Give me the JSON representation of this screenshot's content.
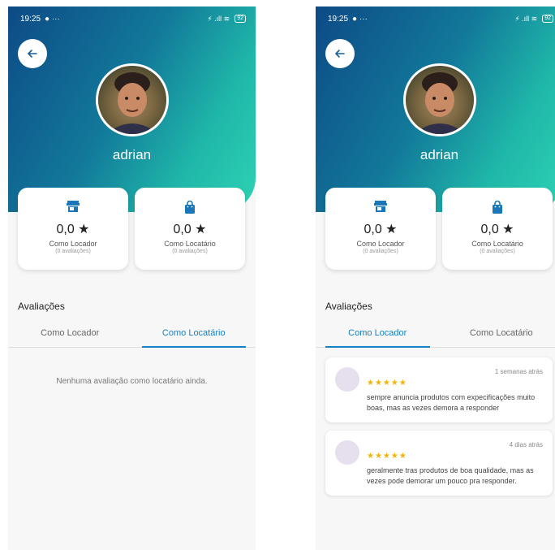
{
  "screens": [
    {
      "status": {
        "time": "19:25",
        "battery": "92"
      },
      "user": {
        "name": "adrian"
      },
      "stats": [
        {
          "icon": "store-icon",
          "value": "0,0 ★",
          "label": "Como Locador",
          "count": "(0 avaliações)"
        },
        {
          "icon": "shopping-bag-icon",
          "value": "0,0 ★",
          "label": "Como Locatário",
          "count": "(0 avaliações)"
        }
      ],
      "section_title": "Avaliações",
      "tabs": [
        {
          "label": "Como Locador",
          "active": false
        },
        {
          "label": "Como Locatário",
          "active": true
        }
      ],
      "empty_message": "Nenhuma avaliação como locatário ainda."
    },
    {
      "status": {
        "time": "19:25",
        "battery": "92"
      },
      "user": {
        "name": "adrian"
      },
      "stats": [
        {
          "icon": "store-icon",
          "value": "0,0 ★",
          "label": "Como Locador",
          "count": "(0 avaliações)"
        },
        {
          "icon": "shopping-bag-icon",
          "value": "0,0 ★",
          "label": "Como Locatário",
          "count": "(0 avaliações)"
        }
      ],
      "section_title": "Avaliações",
      "tabs": [
        {
          "label": "Como Locador",
          "active": true
        },
        {
          "label": "Como Locatário",
          "active": false
        }
      ],
      "reviews": [
        {
          "date": "1 semanas atrás",
          "stars": "★★★★★",
          "rating": 5,
          "text": "sempre anuncia produtos com expecificações muito boas, mas as vezes demora a responder"
        },
        {
          "date": "4 dias atrás",
          "stars": "★★★★★",
          "rating": 5,
          "text": "geralmente tras produtos de boa qualidade, mas as vezes pode demorar um pouco pra responder."
        }
      ]
    }
  ],
  "colors": {
    "gradient_start": "#0d4a86",
    "gradient_end": "#2ed3b4",
    "accent": "#1680c4",
    "star": "#f4b400"
  }
}
